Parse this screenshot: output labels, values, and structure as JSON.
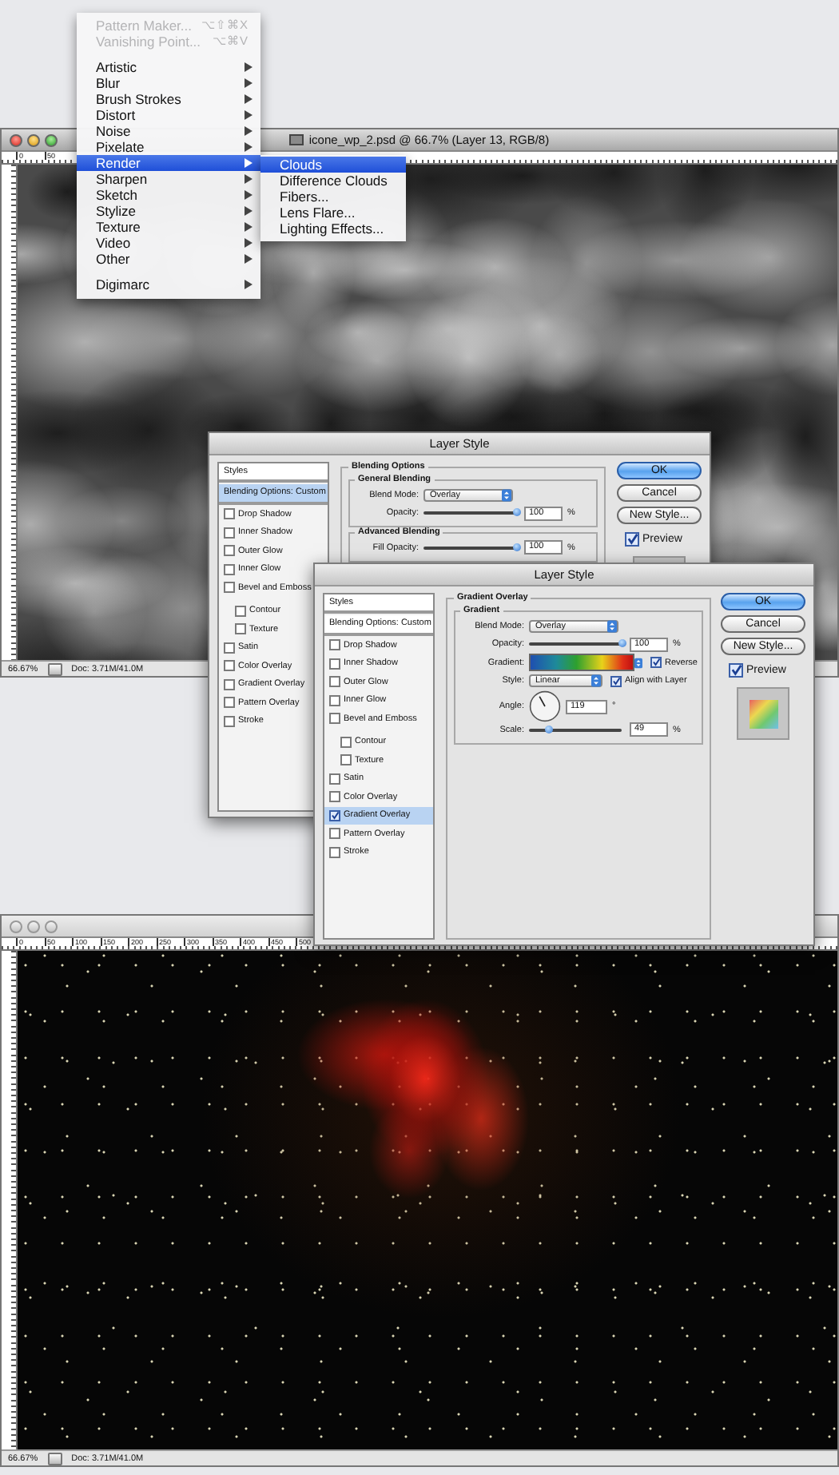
{
  "document_windows": [
    {
      "title": "icone_wp_2.psd @ 66.7% (Layer 13, RGB/8)",
      "active": true,
      "ruler_labels": [
        "0",
        "50"
      ],
      "canvas": {
        "kind": "clouds"
      },
      "zoom": "66.67%",
      "doc_info": "Doc: 3.71M/41.0M"
    },
    {
      "active": false,
      "ruler_labels": [
        "0",
        "50",
        "100",
        "150",
        "200",
        "250",
        "300",
        "350",
        "400",
        "450",
        "500"
      ],
      "canvas": {
        "kind": "nebula"
      },
      "zoom": "66.67%",
      "doc_info": "Doc: 3.71M/41.0M"
    }
  ],
  "filter_menu": {
    "items": [
      {
        "kind": "command",
        "label": "Pattern Maker...",
        "shortcut": "⌥⇧⌘X",
        "disabled": true,
        "selected": false
      },
      {
        "kind": "command",
        "label": "Vanishing Point...",
        "shortcut": "⌥⌘V",
        "disabled": true,
        "selected": false
      },
      {
        "kind": "separator"
      },
      {
        "kind": "submenu",
        "label": "Artistic",
        "disabled": false,
        "selected": false
      },
      {
        "kind": "submenu",
        "label": "Blur",
        "disabled": false,
        "selected": false
      },
      {
        "kind": "submenu",
        "label": "Brush Strokes",
        "disabled": false,
        "selected": false
      },
      {
        "kind": "submenu",
        "label": "Distort",
        "disabled": false,
        "selected": false
      },
      {
        "kind": "submenu",
        "label": "Noise",
        "disabled": false,
        "selected": false
      },
      {
        "kind": "submenu",
        "label": "Pixelate",
        "disabled": false,
        "selected": false
      },
      {
        "kind": "submenu",
        "label": "Render",
        "disabled": false,
        "selected": true,
        "submenu": [
          {
            "label": "Clouds",
            "selected": true
          },
          {
            "label": "Difference Clouds",
            "selected": false
          },
          {
            "label": "Fibers...",
            "selected": false
          },
          {
            "label": "Lens Flare...",
            "selected": false
          },
          {
            "label": "Lighting Effects...",
            "selected": false
          }
        ]
      },
      {
        "kind": "submenu",
        "label": "Sharpen",
        "disabled": false,
        "selected": false
      },
      {
        "kind": "submenu",
        "label": "Sketch",
        "disabled": false,
        "selected": false
      },
      {
        "kind": "submenu",
        "label": "Stylize",
        "disabled": false,
        "selected": false
      },
      {
        "kind": "submenu",
        "label": "Texture",
        "disabled": false,
        "selected": false
      },
      {
        "kind": "submenu",
        "label": "Video",
        "disabled": false,
        "selected": false
      },
      {
        "kind": "submenu",
        "label": "Other",
        "disabled": false,
        "selected": false
      },
      {
        "kind": "separator"
      },
      {
        "kind": "submenu",
        "label": "Digimarc",
        "disabled": false,
        "selected": false
      }
    ]
  },
  "dialogs": [
    {
      "title": "Layer Style",
      "styles": [
        {
          "kind": "header",
          "label": "Styles",
          "selected": false
        },
        {
          "kind": "header",
          "label": "Blending Options: Custom",
          "selected": true
        },
        {
          "kind": "effect",
          "label": "Drop Shadow",
          "checked": false,
          "selected": false
        },
        {
          "kind": "effect",
          "label": "Inner Shadow",
          "checked": false,
          "selected": false
        },
        {
          "kind": "effect",
          "label": "Outer Glow",
          "checked": false,
          "selected": false
        },
        {
          "kind": "effect",
          "label": "Inner Glow",
          "checked": false,
          "selected": false
        },
        {
          "kind": "effect",
          "label": "Bevel and Emboss",
          "checked": false,
          "selected": false,
          "children": [
            {
              "kind": "effect",
              "label": "Contour",
              "checked": false,
              "selected": false
            },
            {
              "kind": "effect",
              "label": "Texture",
              "checked": false,
              "selected": false
            }
          ]
        },
        {
          "kind": "effect",
          "label": "Satin",
          "checked": false,
          "selected": false
        },
        {
          "kind": "effect",
          "label": "Color Overlay",
          "checked": false,
          "selected": false
        },
        {
          "kind": "effect",
          "label": "Gradient Overlay",
          "checked": false,
          "selected": false
        },
        {
          "kind": "effect",
          "label": "Pattern Overlay",
          "checked": false,
          "selected": false
        },
        {
          "kind": "effect",
          "label": "Stroke",
          "checked": false,
          "selected": false
        }
      ],
      "panel": {
        "title": "Blending Options",
        "groups": [
          {
            "title": "General Blending",
            "rows": [
              {
                "kind": "dropdown",
                "label": "Blend Mode:",
                "value": "Overlay"
              },
              {
                "kind": "slider",
                "label": "Opacity:",
                "level": 1,
                "value": "100",
                "unit": "%"
              }
            ]
          },
          {
            "title": "Advanced Blending",
            "rows": [
              {
                "kind": "slider",
                "label": "Fill Opacity:",
                "level": 1,
                "value": "100",
                "unit": "%"
              }
            ]
          }
        ]
      },
      "buttons": [
        {
          "label": "OK",
          "default": true
        },
        {
          "label": "Cancel",
          "default": false
        },
        {
          "label": "New Style...",
          "default": false
        }
      ],
      "preview": {
        "label": "Preview",
        "checked": true,
        "swatch": {
          "kind": "plain"
        }
      }
    },
    {
      "title": "Layer Style",
      "styles": [
        {
          "kind": "header",
          "label": "Styles",
          "selected": false
        },
        {
          "kind": "header",
          "label": "Blending Options: Custom",
          "selected": false
        },
        {
          "kind": "effect",
          "label": "Drop Shadow",
          "checked": false,
          "selected": false
        },
        {
          "kind": "effect",
          "label": "Inner Shadow",
          "checked": false,
          "selected": false
        },
        {
          "kind": "effect",
          "label": "Outer Glow",
          "checked": false,
          "selected": false
        },
        {
          "kind": "effect",
          "label": "Inner Glow",
          "checked": false,
          "selected": false
        },
        {
          "kind": "effect",
          "label": "Bevel and Emboss",
          "checked": false,
          "selected": false,
          "children": [
            {
              "kind": "effect",
              "label": "Contour",
              "checked": false,
              "selected": false
            },
            {
              "kind": "effect",
              "label": "Texture",
              "checked": false,
              "selected": false
            }
          ]
        },
        {
          "kind": "effect",
          "label": "Satin",
          "checked": false,
          "selected": false
        },
        {
          "kind": "effect",
          "label": "Color Overlay",
          "checked": false,
          "selected": false
        },
        {
          "kind": "effect",
          "label": "Gradient Overlay",
          "checked": true,
          "selected": true
        },
        {
          "kind": "effect",
          "label": "Pattern Overlay",
          "checked": false,
          "selected": false
        },
        {
          "kind": "effect",
          "label": "Stroke",
          "checked": false,
          "selected": false
        }
      ],
      "panel": {
        "title": "Gradient Overlay",
        "groups": [
          {
            "title": "Gradient",
            "rows": [
              {
                "kind": "dropdown",
                "label": "Blend Mode:",
                "value": "Overlay"
              },
              {
                "kind": "slider",
                "label": "Opacity:",
                "level": 1,
                "value": "100",
                "unit": "%"
              },
              {
                "kind": "gradient",
                "label": "Gradient:",
                "option": {
                  "label": "Reverse",
                  "checked": true
                }
              },
              {
                "kind": "dropdown",
                "label": "Style:",
                "value": "Linear",
                "option": {
                  "label": "Align with Layer",
                  "checked": true
                }
              },
              {
                "kind": "angle",
                "label": "Angle:",
                "value": "119",
                "unit": "°"
              },
              {
                "kind": "slider",
                "label": "Scale:",
                "level": 0.22,
                "value": "49",
                "unit": "%"
              }
            ]
          }
        ]
      },
      "buttons": [
        {
          "label": "OK",
          "default": true
        },
        {
          "label": "Cancel",
          "default": false
        },
        {
          "label": "New Style...",
          "default": false
        }
      ],
      "preview": {
        "label": "Preview",
        "checked": true,
        "swatch": {
          "kind": "gradient"
        }
      }
    }
  ]
}
